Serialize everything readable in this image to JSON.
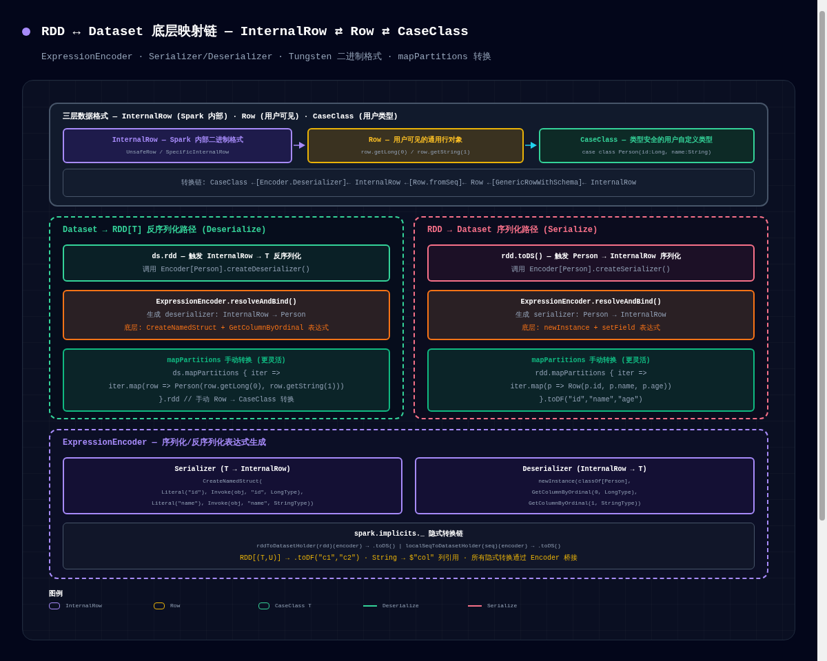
{
  "header": {
    "title": "RDD ↔ Dataset 底层映射链 — InternalRow ⇄ Row ⇄ CaseClass",
    "subtitle": "ExpressionEncoder · Serializer/Deserializer · Tungsten 二进制格式 · mapPartitions 转换"
  },
  "layers": {
    "title": "三层数据格式 — InternalRow (Spark 内部) · Row (用户可见) · CaseClass (用户类型)",
    "boxes": [
      {
        "kind": "internal",
        "title": "InternalRow — Spark 内部二进制格式",
        "detail": "UnsafeRow / SpecificInternalRow"
      },
      {
        "kind": "row",
        "title": "Row — 用户可见的通用行对象",
        "detail": "row.getLong(0) / row.getString(1)"
      },
      {
        "kind": "caseclass",
        "title": "CaseClass — 类型安全的用户自定义类型",
        "detail": "case class Person(id:Long, name:String)"
      }
    ],
    "chain": "转换链: CaseClass ←[Encoder.Deserializer]← InternalRow ←[Row.fromSeq]← Row ←[GenericRowWithSchema]← InternalRow"
  },
  "paths": [
    {
      "kind": "deserialize",
      "title": "Dataset → RDD[T] 反序列化路径 (Deserialize)",
      "steps": [
        {
          "kind": "trigger",
          "title": "ds.rdd — 触发 InternalRow → T 反序列化",
          "lines": [
            "调用 Encoder[Person].createDeserializer()"
          ]
        },
        {
          "kind": "encoder",
          "title": "ExpressionEncoder.resolveAndBind()",
          "lines": [
            "生成 deserializer: InternalRow → Person"
          ],
          "note": "底层: CreateNamedStruct + GetColumnByOrdinal 表达式"
        },
        {
          "kind": "manual",
          "title": "mapPartitions 手动转换 (更灵活)",
          "lines": [
            "ds.mapPartitions { iter =>",
            "iter.map(row => Person(row.getLong(0), row.getString(1)))",
            "}.rdd // 手动 Row → CaseClass 转换"
          ]
        }
      ]
    },
    {
      "kind": "serialize",
      "title": "RDD → Dataset 序列化路径 (Serialize)",
      "steps": [
        {
          "kind": "trigger",
          "title": "rdd.toDS() — 触发 Person → InternalRow 序列化",
          "lines": [
            "调用 Encoder[Person].createSerializer()"
          ]
        },
        {
          "kind": "encoder",
          "title": "ExpressionEncoder.resolveAndBind()",
          "lines": [
            "生成 serializer: Person → InternalRow"
          ],
          "note": "底层: newInstance + setField 表达式"
        },
        {
          "kind": "manual",
          "title": "mapPartitions 手动转换 (更灵活)",
          "lines": [
            "rdd.mapPartitions { iter =>",
            "iter.map(p => Row(p.id, p.name, p.age))",
            "}.toDF(\"id\",\"name\",\"age\")"
          ]
        }
      ]
    }
  ],
  "encoder": {
    "title": "ExpressionEncoder — 序列化/反序列化表达式生成",
    "cards": [
      {
        "title": "Serializer (T → InternalRow)",
        "lines": [
          "CreateNamedStruct(",
          "Literal(\"id\"), Invoke(obj, \"id\", LongType),",
          "Literal(\"name\"), Invoke(obj, \"name\", StringType))"
        ]
      },
      {
        "title": "Deserializer (InternalRow → T)",
        "lines": [
          "newInstance(classOf[Person],",
          "GetColumnByOrdinal(0, LongType),",
          "GetColumnByOrdinal(1, StringType))"
        ]
      }
    ],
    "implicits": {
      "title": "spark.implicits._ 隐式转换链",
      "line": "rddToDatasetHolder(rdd)(encoder) → .toDS() | localSeqToDatasetHolder(seq)(encoder) → .toDS()",
      "note": "RDD[(T,U)] → .toDF(\"c1\",\"c2\") · String → $\"col\" 列引用 · 所有隐式转换通过 Encoder 桥接"
    }
  },
  "legend": {
    "title": "图例",
    "items": [
      {
        "kind": "box",
        "label": "InternalRow",
        "color": "#a78bfa"
      },
      {
        "kind": "box",
        "label": "Row",
        "color": "#eab308"
      },
      {
        "kind": "box",
        "label": "CaseClass T",
        "color": "#34d399"
      },
      {
        "kind": "line",
        "label": "Deserialize",
        "color": "#34d399"
      },
      {
        "kind": "line",
        "label": "Serialize",
        "color": "#f87189"
      }
    ]
  }
}
